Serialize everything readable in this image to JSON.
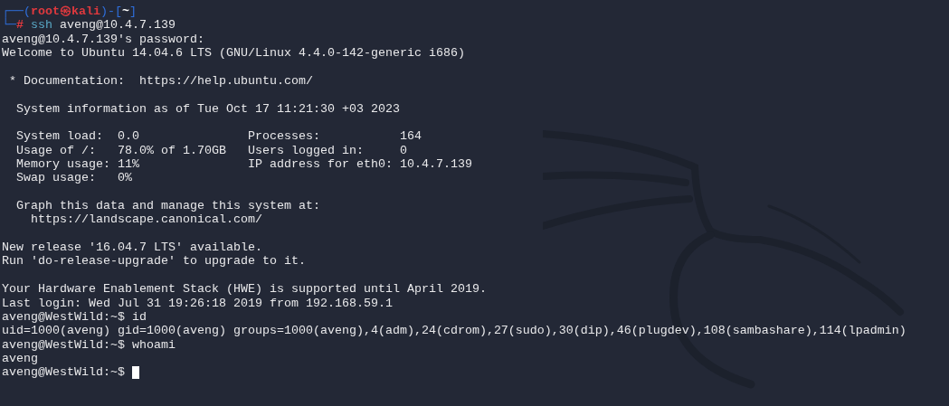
{
  "terminal": {
    "lines": [
      {
        "kind": "prompt-header",
        "open": "┌──(",
        "user": "root㉿kali",
        "mid": ")-[",
        "path": "~",
        "close": "]"
      },
      {
        "kind": "root-command",
        "corner": "└─",
        "hash": "#",
        "command": "ssh",
        "args": "aveng@10.4.7.139"
      },
      {
        "kind": "output",
        "text": "aveng@10.4.7.139's password:"
      },
      {
        "kind": "output",
        "text": "Welcome to Ubuntu 14.04.6 LTS (GNU/Linux 4.4.0-142-generic i686)"
      },
      {
        "kind": "blank"
      },
      {
        "kind": "output",
        "text": " * Documentation:  https://help.ubuntu.com/"
      },
      {
        "kind": "blank"
      },
      {
        "kind": "output",
        "text": "  System information as of Tue Oct 17 11:21:30 +03 2023"
      },
      {
        "kind": "blank"
      },
      {
        "kind": "output",
        "text": "  System load:  0.0               Processes:           164"
      },
      {
        "kind": "output",
        "text": "  Usage of /:   78.0% of 1.70GB   Users logged in:     0"
      },
      {
        "kind": "output",
        "text": "  Memory usage: 11%               IP address for eth0: 10.4.7.139"
      },
      {
        "kind": "output",
        "text": "  Swap usage:   0%"
      },
      {
        "kind": "blank"
      },
      {
        "kind": "output",
        "text": "  Graph this data and manage this system at:"
      },
      {
        "kind": "output",
        "text": "    https://landscape.canonical.com/"
      },
      {
        "kind": "blank"
      },
      {
        "kind": "output",
        "text": "New release '16.04.7 LTS' available."
      },
      {
        "kind": "output",
        "text": "Run 'do-release-upgrade' to upgrade to it."
      },
      {
        "kind": "blank"
      },
      {
        "kind": "output",
        "text": "Your Hardware Enablement Stack (HWE) is supported until April 2019."
      },
      {
        "kind": "output",
        "text": "Last login: Wed Jul 31 19:26:18 2019 from 192.168.59.1"
      },
      {
        "kind": "output",
        "text": "aveng@WestWild:~$ id"
      },
      {
        "kind": "output",
        "text": "uid=1000(aveng) gid=1000(aveng) groups=1000(aveng),4(adm),24(cdrom),27(sudo),30(dip),46(plugdev),108(sambashare),114(lpadmin)"
      },
      {
        "kind": "output",
        "text": "aveng@WestWild:~$ whoami"
      },
      {
        "kind": "output",
        "text": "aveng"
      },
      {
        "kind": "input",
        "text": "aveng@WestWild:~$ "
      }
    ]
  }
}
